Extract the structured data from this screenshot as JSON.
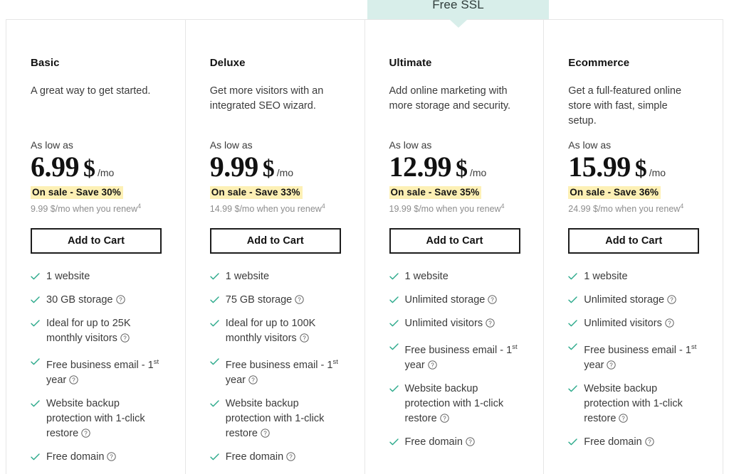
{
  "promo": {
    "label": "Free SSL",
    "banner_color": "#d8eeea",
    "highlighted_plan": "Ultimate"
  },
  "colors": {
    "sale_highlight": "#fdf0b5",
    "check_green": "#2aa98a",
    "text": "#3b3b3b",
    "heading": "#111111",
    "border": "#e6e6e6",
    "button_border": "#1d1d1d"
  },
  "common": {
    "as_low_as_label": "As low as",
    "period_label": "/mo",
    "currency_symbol": "$",
    "cart_button_label": "Add to Cart",
    "check_icon": "check-icon",
    "info_icon": "info-question-icon"
  },
  "plans": [
    {
      "name": "Basic",
      "description": "A great way to get started.",
      "as_low_as": "As low as",
      "price": "6.99",
      "currency": "$",
      "period": "/mo",
      "sale_badge": "On sale - Save 30%",
      "renew_price": "9.99 $/mo when you renew",
      "renew_footnote": "4",
      "cart_button": "Add to Cart",
      "featured": false,
      "features": [
        {
          "text": "1 website",
          "info": false
        },
        {
          "text": "30 GB storage",
          "info": true
        },
        {
          "text": "Ideal for up to 25K monthly visitors",
          "info": true
        },
        {
          "text": "Free business email - 1st year",
          "sup": "st",
          "info": true
        },
        {
          "text": "Website backup protection with 1-click restore",
          "info": true
        },
        {
          "text": "Free domain",
          "info": true
        }
      ]
    },
    {
      "name": "Deluxe",
      "description": "Get more visitors with an integrated SEO wizard.",
      "as_low_as": "As low as",
      "price": "9.99",
      "currency": "$",
      "period": "/mo",
      "sale_badge": "On sale - Save 33%",
      "renew_price": "14.99 $/mo when you renew",
      "renew_footnote": "4",
      "cart_button": "Add to Cart",
      "featured": false,
      "features": [
        {
          "text": "1 website",
          "info": false
        },
        {
          "text": "75 GB storage",
          "info": true
        },
        {
          "text": "Ideal for up to 100K monthly visitors",
          "info": true
        },
        {
          "text": "Free business email - 1st year",
          "sup": "st",
          "info": true
        },
        {
          "text": "Website backup protection with 1-click restore",
          "info": true
        },
        {
          "text": "Free domain",
          "info": true
        }
      ]
    },
    {
      "name": "Ultimate",
      "description": "Add online marketing with more storage and security.",
      "as_low_as": "As low as",
      "price": "12.99",
      "currency": "$",
      "period": "/mo",
      "sale_badge": "On sale - Save 35%",
      "renew_price": "19.99 $/mo when you renew",
      "renew_footnote": "4",
      "cart_button": "Add to Cart",
      "featured": true,
      "features": [
        {
          "text": "1 website",
          "info": false
        },
        {
          "text": "Unlimited storage",
          "info": true
        },
        {
          "text": "Unlimited visitors",
          "info": true
        },
        {
          "text": "Free business email - 1st year",
          "sup": "st",
          "info": true
        },
        {
          "text": "Website backup protection with 1-click restore",
          "info": true
        },
        {
          "text": "Free domain",
          "info": true
        }
      ]
    },
    {
      "name": "Ecommerce",
      "description": "Get a full-featured online store with fast, simple setup.",
      "as_low_as": "As low as",
      "price": "15.99",
      "currency": "$",
      "period": "/mo",
      "sale_badge": "On sale - Save 36%",
      "renew_price": "24.99 $/mo when you renew",
      "renew_footnote": "4",
      "cart_button": "Add to Cart",
      "featured": false,
      "features": [
        {
          "text": "1 website",
          "info": false
        },
        {
          "text": "Unlimited storage",
          "info": true
        },
        {
          "text": "Unlimited visitors",
          "info": true
        },
        {
          "text": "Free business email - 1st year",
          "sup": "st",
          "info": true
        },
        {
          "text": "Website backup protection with 1-click restore",
          "info": true
        },
        {
          "text": "Free domain",
          "info": true
        }
      ]
    }
  ]
}
